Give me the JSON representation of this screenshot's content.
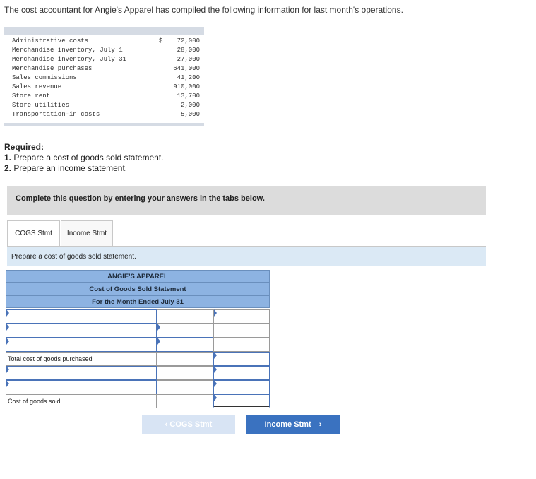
{
  "intro": "The cost accountant for Angie's Apparel has compiled the following information for last month's operations.",
  "info": {
    "currency": "$",
    "rows": [
      {
        "label": "Administrative costs",
        "amount": "72,000"
      },
      {
        "label": "Merchandise inventory, July 1",
        "amount": "28,000"
      },
      {
        "label": "Merchandise inventory, July 31",
        "amount": "27,000"
      },
      {
        "label": "Merchandise purchases",
        "amount": "641,000"
      },
      {
        "label": "Sales commissions",
        "amount": "41,200"
      },
      {
        "label": "Sales revenue",
        "amount": "910,000"
      },
      {
        "label": "Store rent",
        "amount": "13,700"
      },
      {
        "label": "Store utilities",
        "amount": "2,000"
      },
      {
        "label": "Transportation-in costs",
        "amount": "5,000"
      }
    ]
  },
  "required": {
    "heading": "Required:",
    "items": [
      {
        "num": "1.",
        "text": "Prepare a cost of goods sold statement."
      },
      {
        "num": "2.",
        "text": "Prepare an income statement."
      }
    ]
  },
  "banner": "Complete this question by entering your answers in the tabs below.",
  "tabs": [
    {
      "label": "COGS Stmt"
    },
    {
      "label": "Income Stmt"
    }
  ],
  "instruction": "Prepare a cost of goods sold statement.",
  "statement": {
    "company": "ANGIE'S APPAREL",
    "title": "Cost of Goods Sold Statement",
    "period": "For the Month Ended July 31",
    "total_purchased_label": "Total cost of goods purchased",
    "cogs_label": "Cost of goods sold"
  },
  "nav": {
    "prev": "COGS Stmt",
    "next": "Income Stmt",
    "prev_icon": "‹",
    "next_icon": "›"
  }
}
